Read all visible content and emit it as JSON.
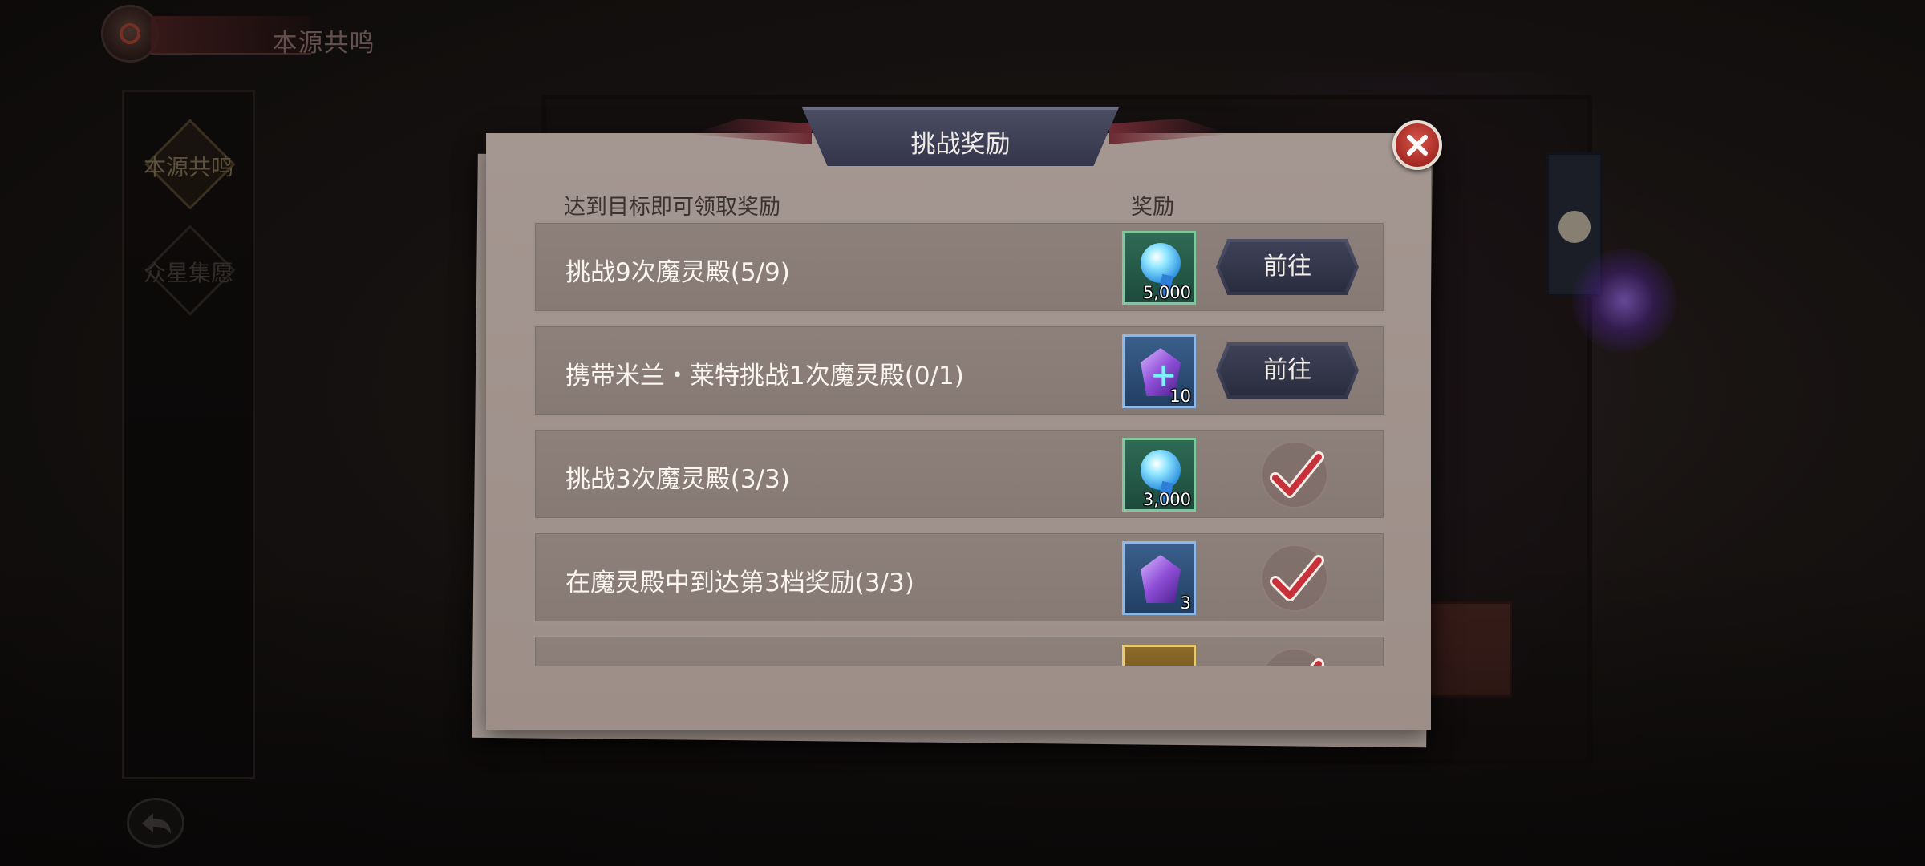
{
  "header": {
    "title": "本源共鸣"
  },
  "sidebar": {
    "items": [
      {
        "label": "本源共鸣"
      },
      {
        "label": "众星集愿"
      }
    ]
  },
  "dialog": {
    "title": "挑战奖励",
    "col_desc": "达到目标即可领取奖励",
    "col_reward": "奖励",
    "rows": [
      {
        "desc": "挑战9次魔灵殿(5/9)",
        "reward_qty": "5,000",
        "action": "前往"
      },
      {
        "desc": "携带米兰・莱特挑战1次魔灵殿(0/1)",
        "reward_qty": "10",
        "action": "前往"
      },
      {
        "desc": "挑战3次魔灵殿(3/3)",
        "reward_qty": "3,000"
      },
      {
        "desc": "在魔灵殿中到达第3档奖励(3/3)",
        "reward_qty": "3"
      },
      {
        "desc": "",
        "reward_qty": ""
      }
    ]
  },
  "icons": {
    "close": "close-icon",
    "back": "back-arrow-icon",
    "checkmark": "checkmark-icon",
    "orb": "soul-orb-icon",
    "crystal_plus": "crystal-plus-icon",
    "crystal": "purple-crystal-icon"
  },
  "colors": {
    "accent": "#33354a",
    "panel": "#a49690",
    "close": "#a52a24",
    "check": "#c8313a"
  }
}
